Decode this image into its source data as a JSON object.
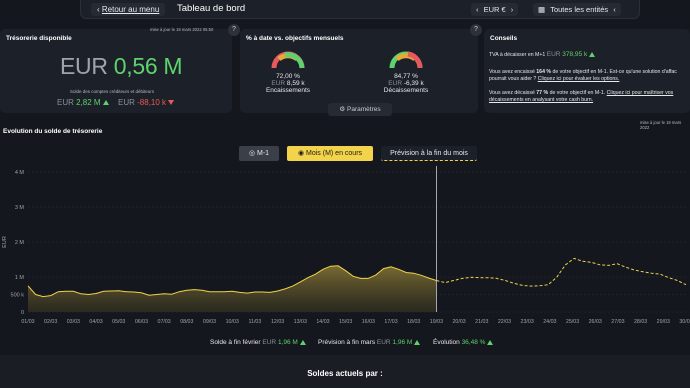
{
  "topbar": {
    "back_label": "Retour au menu",
    "title": "Tableau de bord",
    "currency": "EUR €",
    "entities": "Toutes les entités"
  },
  "tresorerie": {
    "title": "Trésorerie disponible",
    "updated": "mise à jour le 19 mars 2022 05:50",
    "amount_prefix": "EUR ",
    "amount_value": "0,56 M",
    "caption": "Solde des comptes créditeurs et débiteurs",
    "credit_prefix": "EUR ",
    "credit_value": "2,82 M",
    "debit_prefix": "EUR ",
    "debit_value": "-88,10 k"
  },
  "objectifs": {
    "title": "% à date vs. objectifs mensuels",
    "enc_pct": "72,00 %",
    "enc_amount_prefix": "EUR ",
    "enc_amount": "8,59 k",
    "enc_label": "Encaissements",
    "enc_fraction": 0.72,
    "dec_pct": "84,77 %",
    "dec_amount_prefix": "EUR ",
    "dec_amount": "-6,39 k",
    "dec_label": "Décaissements",
    "dec_fraction": 0.8477,
    "params_label": "Paramètres"
  },
  "conseils": {
    "title": "Conseils",
    "tva_text": "TVA à décaisser en M+1",
    "tva_prefix": "EUR ",
    "tva_value": "378,95 k",
    "c2_a": "Vous avez encaissé ",
    "c2_b": "164 %",
    "c2_c": " de votre objectif en M-1. Est-ce qu'une solution d'affac",
    "c2_d": "pourrait vous aider ? ",
    "c2_link": "Cliquez ici pour évaluer les options.",
    "c3_a": "Vous avez décaissé ",
    "c3_b": "77 %",
    "c3_c": " de votre objectif en M-1. ",
    "c3_link1": "Cliquez ici pour maîtriser vos",
    "c3_link2": "décaissements en analysant votre cash burn."
  },
  "evolution": {
    "title": "Evolution du solde de trésorerie",
    "updated": "mise à jour le 19 mars 2022",
    "btn_m1": "M-1",
    "btn_mois": "Mois (M) en cours",
    "btn_prevision": "Prévision à la fin du mois",
    "ylabel": "EUR"
  },
  "chart_data": {
    "type": "area",
    "y_ticks": [
      "4 M",
      "3 M",
      "2 M",
      "1 M",
      "500 k",
      "0"
    ],
    "ylim": [
      0,
      4000000
    ],
    "x_labels": [
      "01/03",
      "02/03",
      "03/03",
      "04/03",
      "05/03",
      "06/03",
      "07/03",
      "08/03",
      "09/03",
      "10/03",
      "11/03",
      "12/03",
      "13/03",
      "14/03",
      "15/03",
      "16/03",
      "17/03",
      "18/03",
      "19/03",
      "20/03",
      "21/03",
      "22/03",
      "23/03",
      "24/03",
      "25/03",
      "26/03",
      "27/03",
      "28/03",
      "29/03",
      "30/03"
    ],
    "series": [
      {
        "values": [
          750000,
          500000,
          440000,
          470000,
          580000,
          590000,
          590000,
          520000,
          500000,
          530000,
          590000,
          600000,
          610000,
          580000,
          570000,
          550000,
          480000,
          500000,
          520000,
          510000,
          580000,
          620000,
          640000,
          620000,
          580000,
          580000,
          580000,
          590000,
          560000,
          540000,
          570000,
          570000,
          560000,
          600000,
          660000,
          740000,
          860000,
          980000,
          1080000,
          1220000,
          1310000,
          1320000,
          1180000,
          1020000,
          960000,
          960000,
          1060000,
          1240000,
          1290000,
          1220000,
          1130000,
          1110000,
          1050000,
          970000,
          900000
        ]
      },
      {
        "values": [
          900000,
          840000,
          900000,
          960000,
          990000,
          980000,
          980000,
          960000,
          900000,
          820000,
          760000,
          740000,
          750000,
          780000,
          1000000,
          1350000,
          1530000,
          1450000,
          1420000,
          1350000,
          1330000,
          1380000,
          1280000,
          1200000,
          1150000,
          1110000,
          1080000,
          980000,
          900000,
          780000
        ]
      }
    ]
  },
  "stats": {
    "solde_fev_label": "Solde à fin février",
    "solde_fev_prefix": "EUR ",
    "solde_fev_value": "1,96 M",
    "prev_label": "Prévision à fin mars",
    "prev_prefix": "EUR ",
    "prev_value": "1,96 M",
    "evol_label": "Évolution",
    "evol_value": "36,48 %"
  },
  "bottom": {
    "soldes_label": "Soldes actuels par :"
  }
}
